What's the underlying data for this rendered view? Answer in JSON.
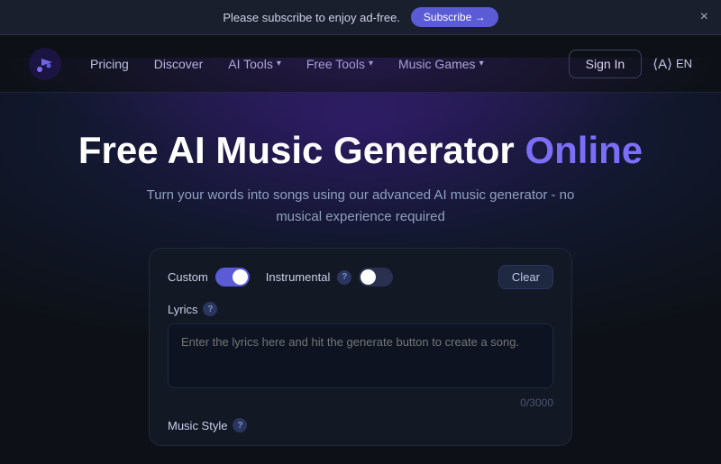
{
  "announcement": {
    "text": "Please subscribe to enjoy ad-free.",
    "subscribe_label": "Subscribe →",
    "close_label": "×"
  },
  "navbar": {
    "pricing_label": "Pricing",
    "discover_label": "Discover",
    "ai_tools_label": "AI Tools",
    "free_tools_label": "Free Tools",
    "music_games_label": "Music Games",
    "sign_in_label": "Sign In",
    "lang_label": "EN"
  },
  "hero": {
    "title_part1": "Free AI Music Generator",
    "title_highlight": "Online",
    "subtitle": "Turn your words into songs using our advanced AI music generator - no musical experience required"
  },
  "generator": {
    "custom_label": "Custom",
    "instrumental_label": "Instrumental",
    "clear_label": "Clear",
    "lyrics_label": "Lyrics",
    "lyrics_placeholder": "Enter the lyrics here and hit the generate button to create a song.",
    "char_count": "0/3000",
    "music_style_label": "Music Style"
  }
}
